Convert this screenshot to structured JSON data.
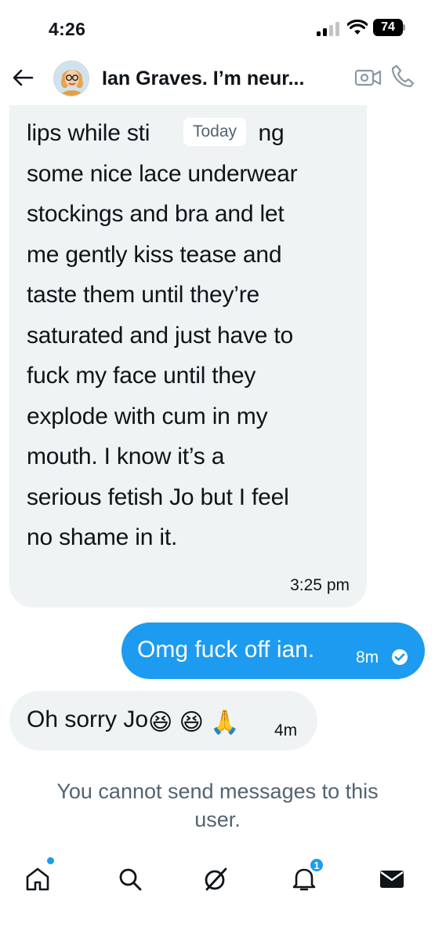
{
  "status_bar": {
    "time": "4:26",
    "battery": "74"
  },
  "header": {
    "back_icon": "arrow-left-icon",
    "contact_name": "Ian Graves. I’m neur...",
    "video_icon": "video-icon",
    "call_icon": "phone-icon"
  },
  "conversation": {
    "date_separator": "Today",
    "messages": [
      {
        "direction": "incoming",
        "text": "lips while sti                 ng\nsome nice lace underwear\nstockings and bra and let\nme gently kiss tease and\ntaste them until they’re\nsaturated and just have to\nfuck my face until they\nexplode with cum in my\nmouth. I know it’s a\nserious fetish Jo but I feel\nno shame in it.",
        "time": "3:25 pm"
      },
      {
        "direction": "outgoing",
        "text": "Omg fuck off ian.",
        "time": "8m",
        "status_icon": "check-circle-icon"
      },
      {
        "direction": "incoming",
        "text": "Oh sorry Jo",
        "emojis": [
          "😆",
          "😆",
          "🙏"
        ],
        "time": "4m"
      }
    ],
    "notice": "You cannot send messages to this user."
  },
  "bottom_nav": {
    "items": [
      "home-icon",
      "search-icon",
      "grok-icon",
      "notifications-icon",
      "messages-icon"
    ],
    "notifications_badge": "1"
  },
  "colors": {
    "accent": "#1d9bf0",
    "incoming_bubble": "#eff3f4",
    "muted_text": "#536471"
  }
}
